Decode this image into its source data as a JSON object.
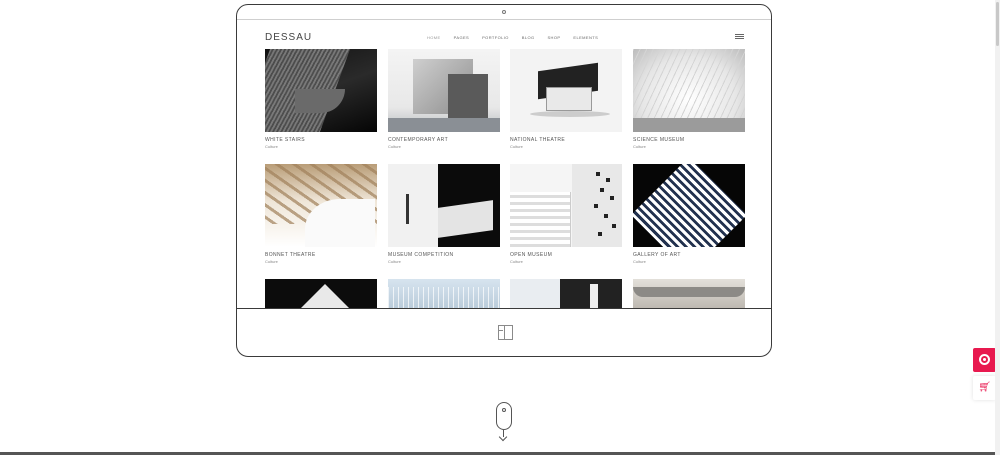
{
  "site": {
    "logo": "DESSAU",
    "nav": [
      "HOME",
      "PAGES",
      "PORTFOLIO",
      "BLOG",
      "SHOP",
      "ELEMENTS"
    ]
  },
  "portfolio": [
    {
      "title": "WHITE STAIRS",
      "category": "Culture"
    },
    {
      "title": "CONTEMPORARY ART",
      "category": "Culture"
    },
    {
      "title": "NATIONAL THEATRE",
      "category": "Culture"
    },
    {
      "title": "SCIENCE MUSEUM",
      "category": "Culture"
    },
    {
      "title": "BONNET THEATRE",
      "category": "Culture"
    },
    {
      "title": "MUSEUM COMPETITION",
      "category": "Culture"
    },
    {
      "title": "OPEN MUSEUM",
      "category": "Culture"
    },
    {
      "title": "GALLERY OF ART",
      "category": "Culture"
    }
  ],
  "colors": {
    "accent": "#e8194f",
    "frame": "#3a3a3a"
  },
  "icons": {
    "side_top": "target-icon",
    "side_bottom": "cart-icon",
    "chin": "layout-icon",
    "scroll": "mouse-scroll-icon"
  }
}
